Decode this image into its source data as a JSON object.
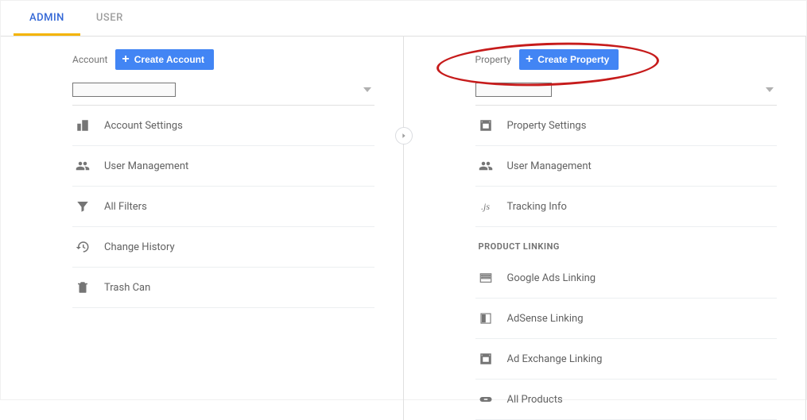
{
  "tabs": {
    "admin": "ADMIN",
    "user": "USER"
  },
  "account": {
    "label": "Account",
    "create_btn": "Create Account",
    "items": [
      {
        "icon": "company",
        "label": "Account Settings"
      },
      {
        "icon": "group",
        "label": "User Management"
      },
      {
        "icon": "filter",
        "label": "All Filters"
      },
      {
        "icon": "history",
        "label": "Change History"
      },
      {
        "icon": "trash",
        "label": "Trash Can"
      }
    ]
  },
  "property": {
    "label": "Property",
    "create_btn": "Create Property",
    "items": [
      {
        "icon": "window-square",
        "label": "Property Settings"
      },
      {
        "icon": "group",
        "label": "User Management"
      },
      {
        "icon": "js",
        "label": "Tracking Info"
      }
    ],
    "section_heading": "PRODUCT LINKING",
    "linking": [
      {
        "icon": "ads",
        "label": "Google Ads Linking"
      },
      {
        "icon": "adsense",
        "label": "AdSense Linking"
      },
      {
        "icon": "window-square",
        "label": "Ad Exchange Linking"
      },
      {
        "icon": "link",
        "label": "All Products"
      }
    ]
  }
}
